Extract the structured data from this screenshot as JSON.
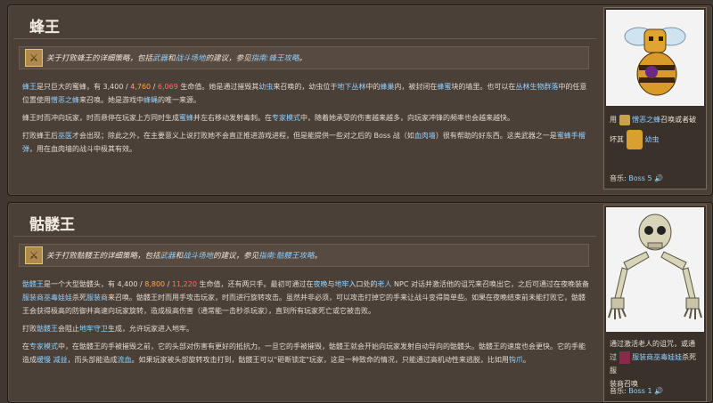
{
  "queen_bee": {
    "title": "蜂王",
    "notice": {
      "pre": "关于打败蜂王的详细策略，包括",
      "link1": "武器",
      "mid1": "和",
      "link2": "战斗场地",
      "mid2": "的建议，参见",
      "link3": "指南:蜂王攻略",
      "post": "。"
    },
    "p1": {
      "a": "蜂王",
      "b": "是只巨大的蜜蜂，有 3,400 / ",
      "hp_expert": "4,760",
      "sep": " / ",
      "hp_master": "6,069",
      "c": " 生命值。她是通过摧毁其",
      "link_larva": "幼虫",
      "d": "来召唤的，幼虫位于",
      "link_jungle": "地下丛林",
      "e": "中的",
      "link_hive": "蜂巢",
      "f": "内，被封闭在",
      "link_hive2": "蜂蜜",
      "g": "块的墙里。也可以在",
      "link_biome": "丛林生物群落",
      "h": "中的任意位置使用",
      "link_item": "憎恶之蜂",
      "i": "来召唤。她是游戏中",
      "link_bee": "蜂蝇",
      "j": "的唯一来源。"
    },
    "p2": {
      "a": "蜂王时而冲向玩家，时而悬停在玩家上方同时生成",
      "link1": "蜜蜂",
      "b": "并左右移动发射毒刺。在",
      "link2": "专家模式",
      "c": "中，随着她承受的伤害越来越多，向玩家冲锋的频率也会越来越快。"
    },
    "p3": {
      "a": "打败蜂王后",
      "link1": "巫医",
      "b": "才会出现；除此之外，在主要意义上说打败她不会直正推进游戏进程，但是能提供一些对之后的 Boss 战（如",
      "link2": "血肉墙",
      "c": "）很有帮助的好东西。这类武器之一是",
      "link3": "蜜蜂手榴弹",
      "d": "，用在血肉墙的战斗中极其有效。"
    },
    "info": {
      "use_pre": "用",
      "use_item": "憎恶之蜂",
      "use_post": "召唤或者破",
      "break_pre": "坏其",
      "break_item": "幼虫",
      "music_label": "音乐: ",
      "music_value": "Boss 5",
      "speaker": "🔊"
    }
  },
  "skeletron": {
    "title": "骷髅王",
    "notice": {
      "pre": "关于打败骷髅王的详细策略，包括",
      "link1": "武器",
      "mid1": "和",
      "link2": "战斗场地",
      "mid2": "的建议，参见",
      "link3": "指南:骷髅王攻略",
      "post": "。"
    },
    "p1": {
      "a": "骷髅王",
      "b": "是一个大型骷髅头，有 4,400 / ",
      "hp_expert": "8,800",
      "sep": " / ",
      "hp_master": "11,220",
      "c": " 生命值，还有两只手。最初可通过在",
      "link1": "夜晚",
      "d": "与",
      "link2": "地牢",
      "e": "入口处的",
      "link3": "老人",
      "f": " NPC 对话并激活他的诅咒来召唤出它，之后可通过在夜晚装备",
      "link4": "服装商巫毒娃娃",
      "g": "杀死",
      "link5": "服装商",
      "h": "来召唤。骷髅王时而用手攻击玩家，时而进行旋转攻击。虽然并非必须，可以攻击打掉它的手来让战斗变得简单些。如果在夜晚结束前未能打败它，骷髅王会获得极高的防御并高速向玩家旋转，造成极高伤害（通常能一击秒杀玩家），直到所有玩家死亡或它被击败。"
    },
    "p2": {
      "a": "打败",
      "link1": "骷髅王",
      "b": "会阻止",
      "link2": "地牢守卫",
      "c": "生成，允许玩家进入地牢。"
    },
    "p3": {
      "a": "在",
      "link1": "专家模式",
      "b": "中，在骷髅王的手被摧毁之前，它的头部对伤害有更好的抵抗力。一旦它的手被摧毁，骷髅王就会开始向玩家发射自动导向的骷髅头。骷髅王的速度也会更快。它的手能造成",
      "link2": "缓慢",
      "sep": " ",
      "link3": "减益",
      "c": "，而头部能造成",
      "link4": "流血",
      "d": "。如果玩家被头部旋转攻击打到，骷髅王可以\"砸断锁定\"玩家，这是一种致命的情况，只能通过高机动性来逃脱，比如用",
      "link5": "钩爪",
      "e": "。"
    },
    "info": {
      "line1": "通过激活老人的诅咒，或通",
      "line2_pre": "过",
      "line2_item": "服装商巫毒娃娃",
      "line2_post": "杀死服",
      "line3": "装商召唤",
      "music_label": "音乐: ",
      "music_value": "Boss 1",
      "speaker": "🔊"
    }
  }
}
